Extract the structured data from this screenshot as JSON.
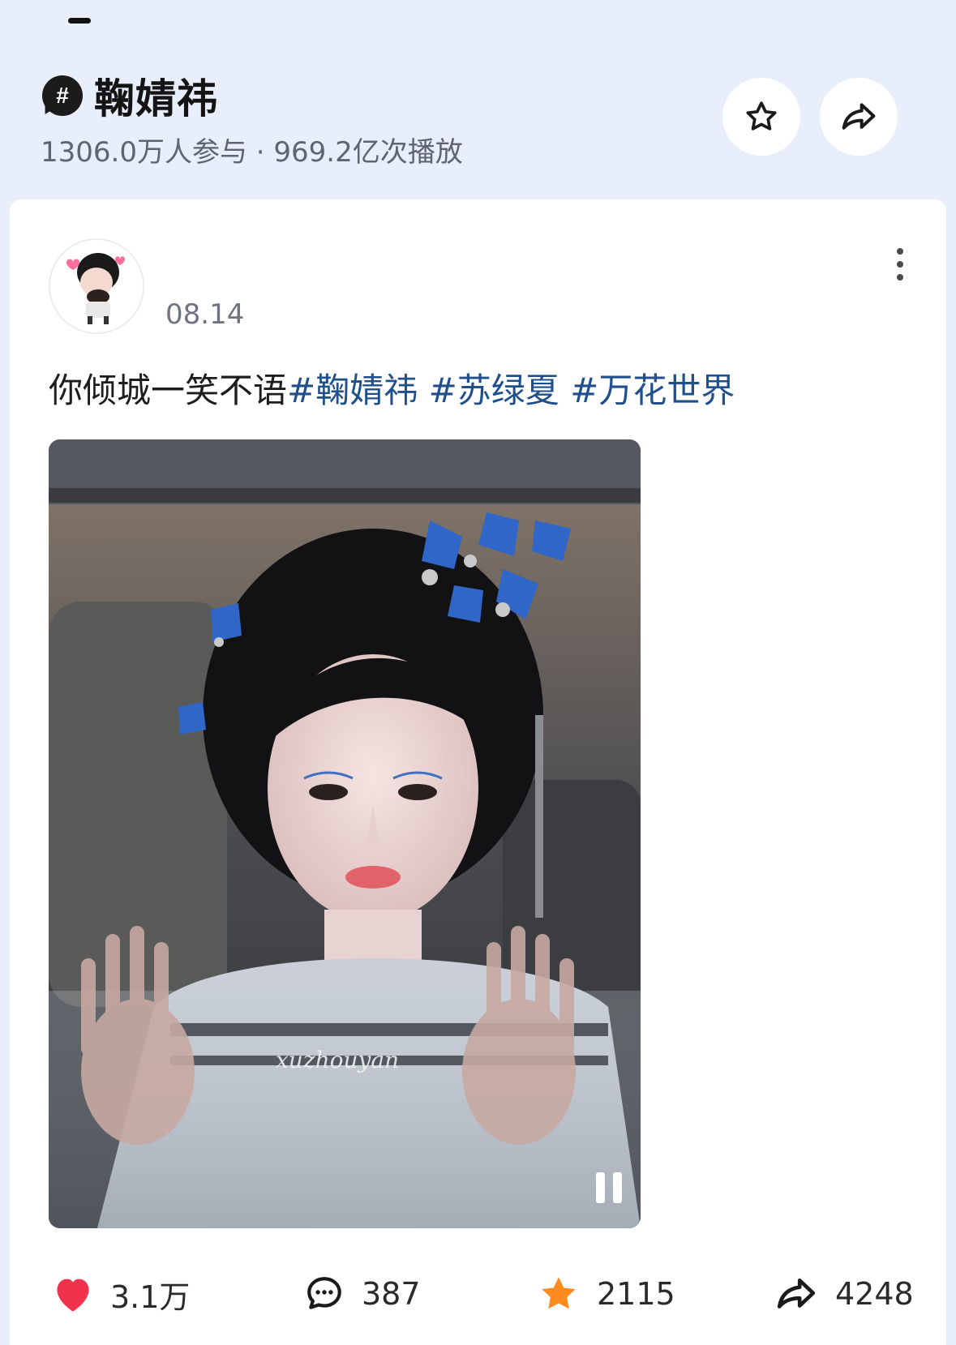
{
  "topic": {
    "hash_symbol": "#",
    "title": "鞠婧祎",
    "stats": "1306.0万人参与 · 969.2亿次播放"
  },
  "post": {
    "date": "08.14",
    "caption_text": "你倾城一笑不语",
    "tags": [
      "#鞠婧祎",
      "#苏绿夏",
      "#万花世界"
    ],
    "watermark": "xuzhouyan"
  },
  "actions": {
    "like_count": "3.1万",
    "comment_count": "387",
    "favorite_count": "2115",
    "share_count": "4248"
  },
  "colors": {
    "background": "#e9eefb",
    "tag": "#1f4f8c",
    "like": "#f0324c",
    "favorite": "#ff8a1e"
  }
}
